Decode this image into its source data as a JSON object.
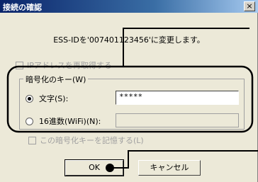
{
  "window": {
    "title": "接続の確認",
    "close_glyph": "×"
  },
  "message": "ESS-IDを'007401123456'に変更します。",
  "reacquire_ip": {
    "label": "IPアドレスを再取得する",
    "checked": false,
    "enabled": false
  },
  "encryption": {
    "group_label": "暗号化のキー(W)",
    "options": [
      {
        "label": "文字(S):",
        "selected": true,
        "value": "*****"
      },
      {
        "label": "16進数(WiFi)(N):",
        "selected": false,
        "value": ""
      }
    ]
  },
  "remember_key": {
    "label": "この暗号化キーを記憶する(L)",
    "checked": false,
    "enabled": false
  },
  "buttons": {
    "ok": "OK",
    "cancel": "キャンセル"
  },
  "colors": {
    "dialog_bg": "#ece9d8",
    "titlebar": "#0a246a",
    "annotation": "#000000"
  }
}
